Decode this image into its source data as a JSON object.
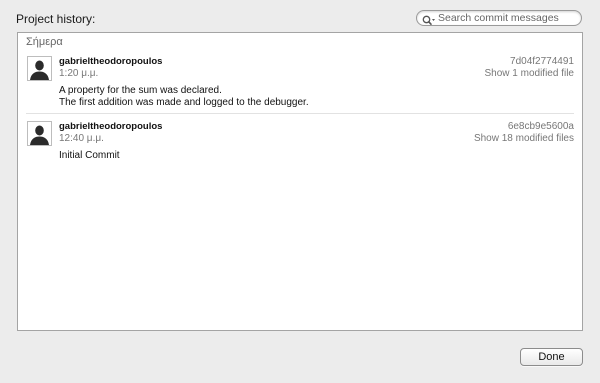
{
  "window": {
    "title": "Project history:"
  },
  "search": {
    "placeholder": "Search commit messages",
    "value": ""
  },
  "history": {
    "section_label": "Σήμερα",
    "commits": [
      {
        "author": "gabrieltheodoropoulos",
        "time": "1:20 μ.μ.",
        "hash": "7d04f2774491",
        "files_link": "Show 1 modified file",
        "message_lines": [
          "A property for the sum was declared.",
          "The first addition was made and logged to the debugger."
        ]
      },
      {
        "author": "gabrieltheodoropoulos",
        "time": "12:40 μ.μ.",
        "hash": "6e8cb9e5600a",
        "files_link": "Show 18 modified files",
        "message_lines": [
          "Initial Commit"
        ]
      }
    ]
  },
  "footer": {
    "done_label": "Done"
  },
  "icons": {
    "search": "magnifier-with-dropdown-icon",
    "avatar": "user-silhouette-icon"
  }
}
